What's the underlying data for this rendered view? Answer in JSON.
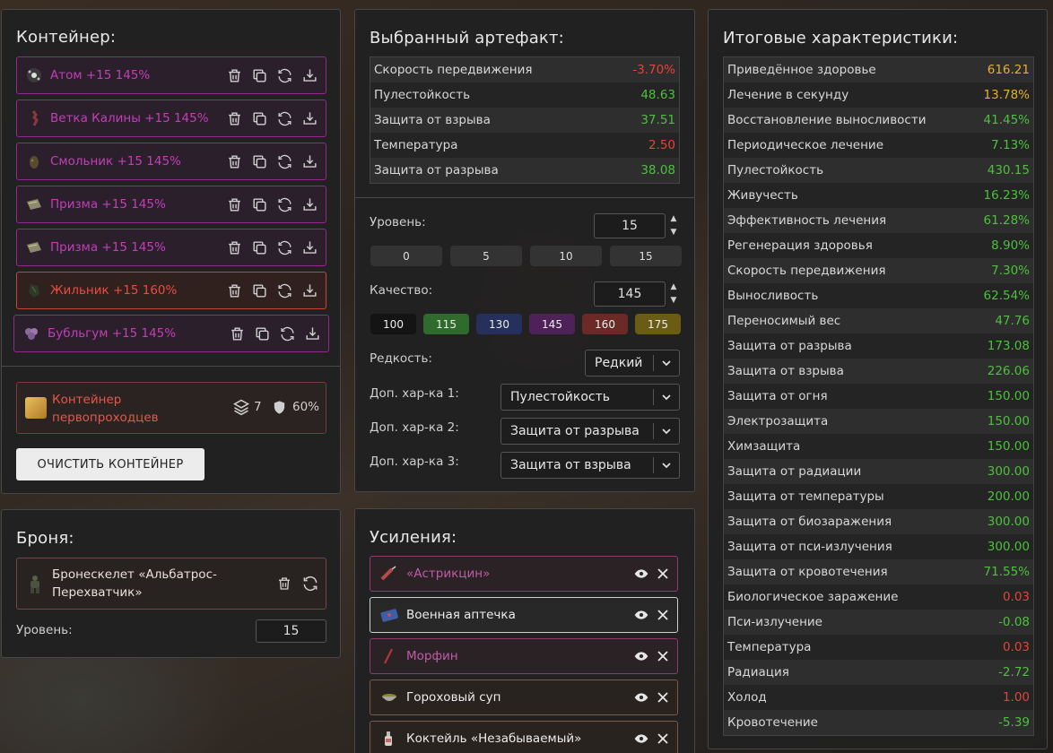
{
  "container": {
    "title": "Контейнер:",
    "items": [
      {
        "name": "Атом +15 145%",
        "color": "purple",
        "icon": "atom-artifact-icon"
      },
      {
        "name": "Ветка Калины +15 145%",
        "color": "purple",
        "icon": "kalina-branch-artifact-icon"
      },
      {
        "name": "Смольник +15 145%",
        "color": "purple",
        "icon": "smolnik-artifact-icon"
      },
      {
        "name": "Призма +15 145%",
        "color": "purple",
        "icon": "prism-artifact-icon"
      },
      {
        "name": "Призма +15 145%",
        "color": "purple",
        "icon": "prism-artifact-icon"
      },
      {
        "name": "Жильник +15 160%",
        "color": "red",
        "icon": "zhilnik-artifact-icon"
      },
      {
        "name": "Бубльгум +15 145%",
        "color": "purple",
        "icon": "bubblegum-artifact-icon"
      }
    ],
    "summary": {
      "name": "Контейнер первопроходцев",
      "slots": "7",
      "protection": "60%"
    },
    "clear_button": "ОЧИСТИТЬ КОНТЕЙНЕР"
  },
  "armor": {
    "title": "Броня:",
    "item_name": "Бронескелет «Альбатрос-Перехватчик»",
    "level_label": "Уровень:",
    "level_value": "15"
  },
  "selected": {
    "title": "Выбранный артефакт:",
    "stats": [
      {
        "label": "Скорость передвижения",
        "value": "-3.70%",
        "tone": "red"
      },
      {
        "label": "Пулестойкость",
        "value": "48.63",
        "tone": "green"
      },
      {
        "label": "Защита от взрыва",
        "value": "37.51",
        "tone": "green"
      },
      {
        "label": "Температура",
        "value": "2.50",
        "tone": "red"
      },
      {
        "label": "Защита от разрыва",
        "value": "38.08",
        "tone": "green"
      }
    ],
    "level_label": "Уровень:",
    "level_value": "15",
    "level_presets": [
      "0",
      "5",
      "10",
      "15"
    ],
    "quality_label": "Качество:",
    "quality_value": "145",
    "quality_presets": [
      {
        "label": "100",
        "color": "#141414"
      },
      {
        "label": "115",
        "color": "#2f6b2c"
      },
      {
        "label": "130",
        "color": "#25305c"
      },
      {
        "label": "145",
        "color": "#4e2258"
      },
      {
        "label": "160",
        "color": "#6c2a26"
      },
      {
        "label": "175",
        "color": "#6a5c14"
      }
    ],
    "rarity_label": "Редкость:",
    "rarity_value": "Редкий",
    "extra1_label": "Доп. хар-ка 1:",
    "extra1_value": "Пулестойкость",
    "extra2_label": "Доп. хар-ка 2:",
    "extra2_value": "Защита от разрыва",
    "extra3_label": "Доп. хар-ка 3:",
    "extra3_value": "Защита от взрыва"
  },
  "boosts": {
    "title": "Усиления:",
    "items": [
      {
        "name": "«Астрикцин»",
        "style": "purple",
        "icon": "syringe-icon"
      },
      {
        "name": "Военная аптечка",
        "style": "white",
        "icon": "medkit-icon"
      },
      {
        "name": "Морфин",
        "style": "purple",
        "icon": "morphine-syringe-icon"
      },
      {
        "name": "Гороховый суп",
        "style": "white",
        "icon": "soup-bowl-icon"
      },
      {
        "name": "Коктейль «Незабываемый»",
        "style": "white",
        "icon": "bottle-icon"
      }
    ]
  },
  "totals": {
    "title": "Итоговые характеристики:",
    "stats": [
      {
        "label": "Приведённое здоровье",
        "value": "616.21",
        "tone": "gold"
      },
      {
        "label": "Лечение в секунду",
        "value": "13.78%",
        "tone": "gold"
      },
      {
        "label": "Восстановление выносливости",
        "value": "41.45%",
        "tone": "green"
      },
      {
        "label": "Периодическое лечение",
        "value": "7.13%",
        "tone": "green"
      },
      {
        "label": "Пулестойкость",
        "value": "430.15",
        "tone": "green"
      },
      {
        "label": "Живучесть",
        "value": "16.23%",
        "tone": "green"
      },
      {
        "label": "Эффективность лечения",
        "value": "61.28%",
        "tone": "green"
      },
      {
        "label": "Регенерация здоровья",
        "value": "8.90%",
        "tone": "green"
      },
      {
        "label": "Скорость передвижения",
        "value": "7.30%",
        "tone": "green"
      },
      {
        "label": "Выносливость",
        "value": "62.54%",
        "tone": "green"
      },
      {
        "label": "Переносимый вес",
        "value": "47.76",
        "tone": "green"
      },
      {
        "label": "Защита от разрыва",
        "value": "173.08",
        "tone": "green"
      },
      {
        "label": "Защита от взрыва",
        "value": "226.06",
        "tone": "green"
      },
      {
        "label": "Защита от огня",
        "value": "150.00",
        "tone": "green"
      },
      {
        "label": "Электрозащита",
        "value": "150.00",
        "tone": "green"
      },
      {
        "label": "Химзащита",
        "value": "150.00",
        "tone": "green"
      },
      {
        "label": "Защита от радиации",
        "value": "300.00",
        "tone": "green"
      },
      {
        "label": "Защита от температуры",
        "value": "200.00",
        "tone": "green"
      },
      {
        "label": "Защита от биозаражения",
        "value": "300.00",
        "tone": "green"
      },
      {
        "label": "Защита от пси-излучения",
        "value": "300.00",
        "tone": "green"
      },
      {
        "label": "Защита от кровотечения",
        "value": "71.55%",
        "tone": "green"
      },
      {
        "label": "Биологическое заражение",
        "value": "0.03",
        "tone": "red"
      },
      {
        "label": "Пси-излучение",
        "value": "-0.08",
        "tone": "green"
      },
      {
        "label": "Температура",
        "value": "0.03",
        "tone": "red"
      },
      {
        "label": "Радиация",
        "value": "-2.72",
        "tone": "green"
      },
      {
        "label": "Холод",
        "value": "1.00",
        "tone": "red"
      },
      {
        "label": "Кровотечение",
        "value": "-5.39",
        "tone": "green"
      }
    ]
  },
  "colors": {
    "purple": "#c23fb7",
    "red": "#ec4b3f",
    "green": "#4fbf3f",
    "gold": "#e3b030"
  }
}
